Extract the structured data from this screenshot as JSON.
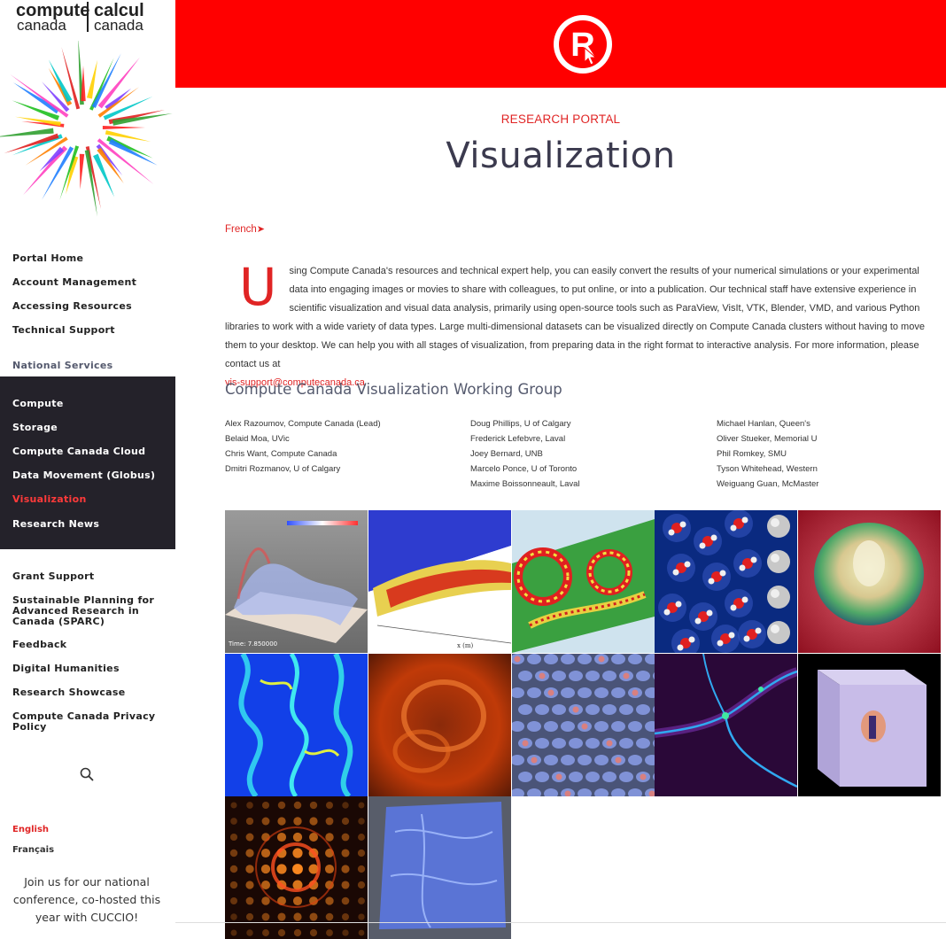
{
  "sidebar": {
    "logo": {
      "line1_left": "compute",
      "line2_left": "canada",
      "line1_right": "calcul",
      "line2_right": "canada"
    },
    "nav_top": [
      "Portal Home",
      "Account Management",
      "Accessing Resources",
      "Technical Support"
    ],
    "section_label": "National Services",
    "nav_services": [
      "Compute",
      "Storage",
      "Compute Canada Cloud",
      "Data Movement (Globus)",
      "Visualization",
      "Research News"
    ],
    "nav_bottom": [
      "Grant Support",
      "Sustainable Planning for Advanced Research in Canada (SPARC)",
      "Feedback",
      "Digital Humanities",
      "Research Showcase",
      "Compute Canada Privacy Policy"
    ],
    "languages": [
      "English",
      "Français"
    ],
    "conference_text": "Join us for our national conference, co-hosted this year with CUCCIO!"
  },
  "header": {
    "logo_icon": "research-portal-r-icon",
    "color": "#ff0000"
  },
  "main": {
    "portal_label": "RESEARCH PORTAL",
    "title": "Visualization",
    "french_link": "French",
    "intro_dropcap": "U",
    "intro_text": "sing Compute Canada's resources and technical expert help, you can easily convert the results of your numerical simulations or your experimental data into engaging images or movies to share with colleagues, to put online, or into a publication. Our technical staff have extensive experience in scientific visualization and visual data analysis, primarily using open-source tools such as ParaView, VisIt, VTK, Blender, VMD, and various Python libraries to work with a wide variety of data types. Large multi-dimensional datasets can be visualized directly on Compute Canada clusters without having to move them to your desktop. We can help you with all stages of visualization, from preparing data in the right format to interactive analysis. For more information, please contact us at",
    "contact_email": "vis-support@computecanada.ca",
    "working_group_title": "Compute Canada Visualization Working Group",
    "members": [
      [
        "Alex Razoumov, Compute Canada (Lead)",
        "Belaid Moa, UVic",
        "Chris Want, Compute Canada",
        "Dmitri Rozmanov, U of Calgary"
      ],
      [
        "Doug Phillips, U of Calgary",
        "Frederick Lefebvre, Laval",
        "Joey Bernard, UNB",
        "Marcelo Ponce, U of Toronto",
        "Maxime Boissonneault, Laval"
      ],
      [
        "Michael Hanlan, Queen's",
        "Oliver Stueker, Memorial U",
        "Phil Romkey, SMU",
        "Tyson Whitehead, Western",
        "Weiguang Guan, McMaster"
      ]
    ],
    "gallery_labels": {
      "time_stamp": "Time: 7.850000",
      "axis_label": "x (m)"
    }
  },
  "colors": {
    "accent": "#e02424",
    "header_red": "#ff0000",
    "dark_nav": "#24222a",
    "title": "#3b3a4e"
  }
}
